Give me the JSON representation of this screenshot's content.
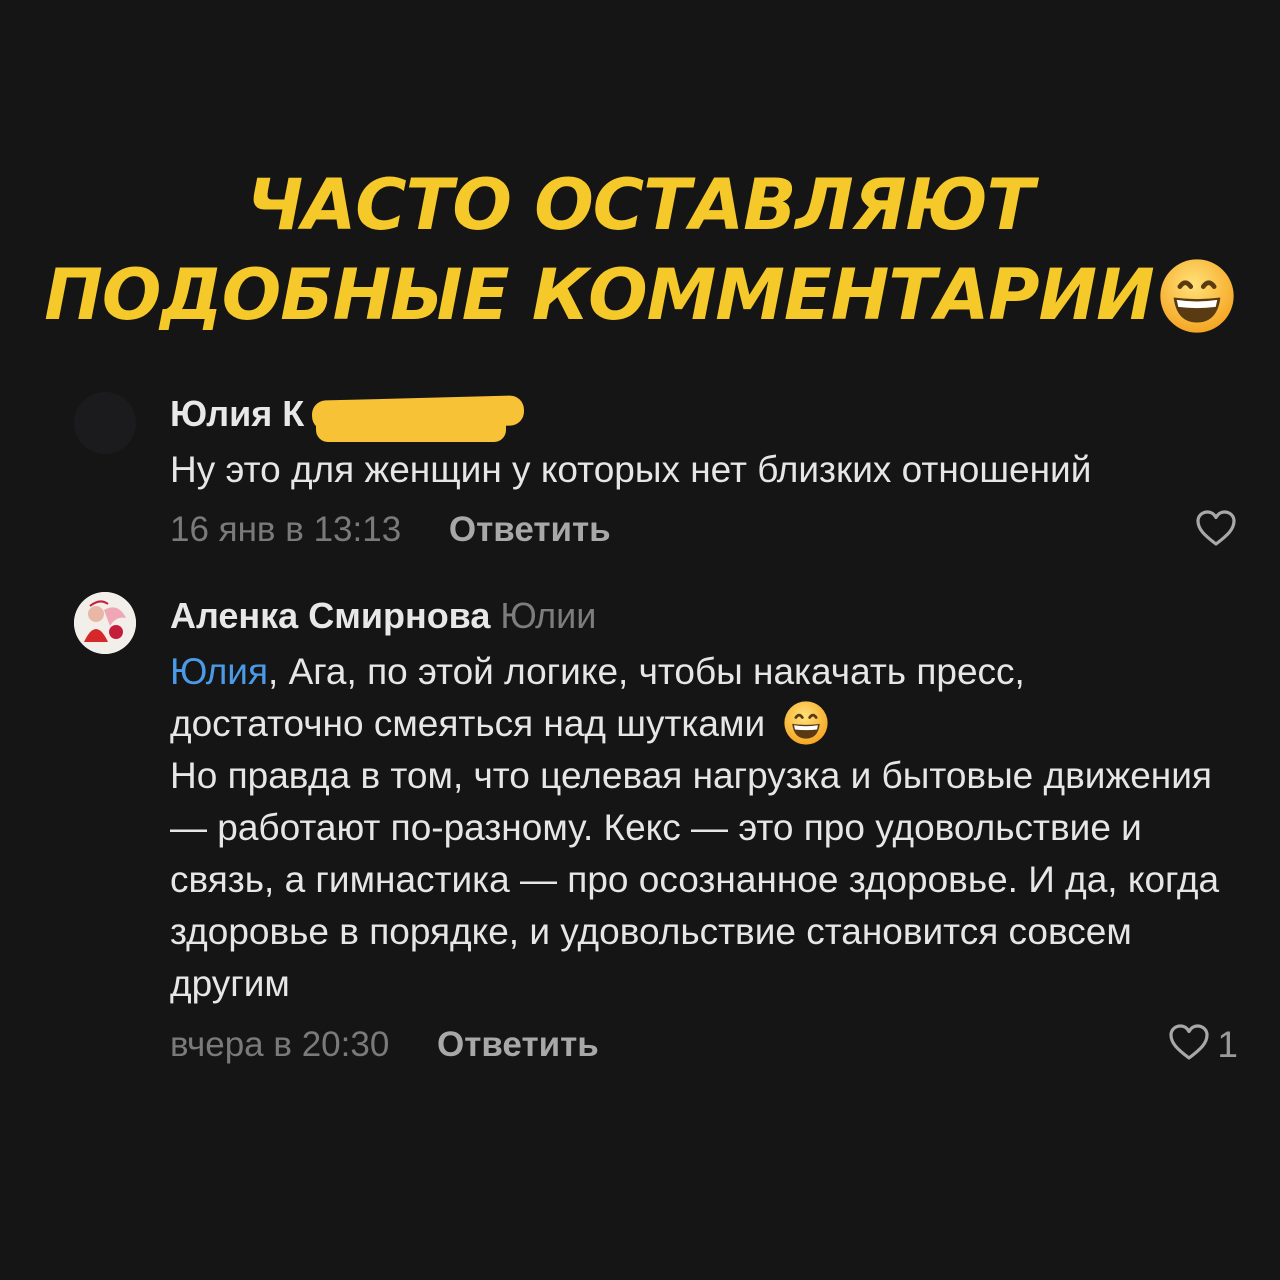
{
  "headline": {
    "line1": "ЧАСТО ОСТАВЛЯЮТ",
    "line2": "ПОДОБНЫЕ КОММЕНТАРИИ",
    "emoji_icon": "grinning-face-emoji"
  },
  "comments": [
    {
      "author": "Юлия К",
      "text": "Ну это для женщин у которых нет близких отношений",
      "time": "16 янв в 13:13",
      "reply_label": "Ответить",
      "like_icon": "heart-outline-icon",
      "redaction_color": "#f8c236"
    },
    {
      "author": "Аленка Смирнова",
      "reply_to": "Юлии",
      "mention": "Юлия",
      "text_line1_after_mention": ", Ага, по этой логике, чтобы накачать пресс,",
      "text_line2": "достаточно смеяться над шутками",
      "text_rest": "Но правда в том, что целевая нагрузка и бытовые движения — работают по-разному. Кекс — это про удовольствие и связь, а гимнастика — про осознанное здоровье. И да, когда здоровье в порядке, и удовольствие становится совсем другим",
      "time": "вчера в 20:30",
      "reply_label": "Ответить",
      "like_icon": "heart-outline-icon",
      "like_count": "1",
      "mention_color": "#4a9ae8"
    }
  ],
  "colors": {
    "background": "#151515",
    "headline": "#f6c92a",
    "secondary_text": "#7a7a7a"
  }
}
